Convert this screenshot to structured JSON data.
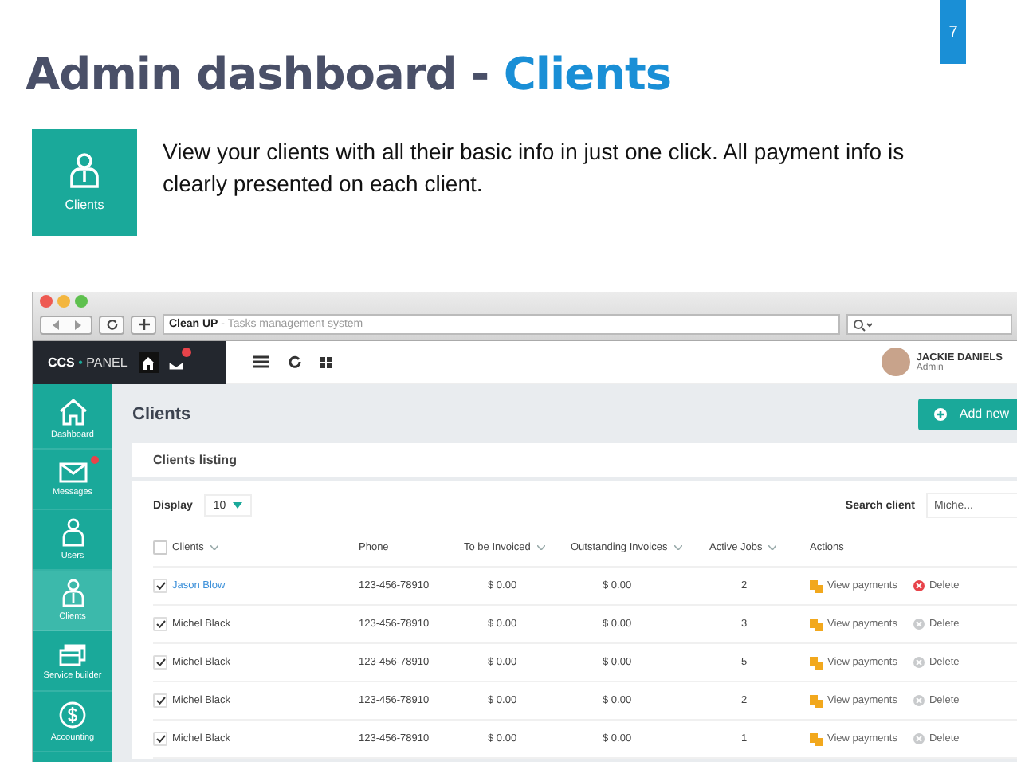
{
  "slide": {
    "page_number": "7",
    "title": "Admin dashboard - ",
    "title_highlight": "Clients",
    "tile_label": "Clients",
    "description": "View your clients with all their basic info in just one click. All payment info is clearly presented on each client."
  },
  "browser": {
    "address_title": "Clean UP",
    "address_rest": " - Tasks management system"
  },
  "header": {
    "brand": "CCS",
    "separator": "•",
    "brand_rest": "PANEL",
    "user_name": "JACKIE DANIELS",
    "user_role": "Admin"
  },
  "sidebar": {
    "items": [
      {
        "label": "Dashboard",
        "selected": false,
        "badge": false
      },
      {
        "label": "Messages",
        "selected": false,
        "badge": true
      },
      {
        "label": "Users",
        "selected": false,
        "badge": false
      },
      {
        "label": "Clients",
        "selected": true,
        "badge": false
      },
      {
        "label": "Service builder",
        "selected": false,
        "badge": false
      },
      {
        "label": "Accounting",
        "selected": false,
        "badge": false
      }
    ]
  },
  "page": {
    "title": "Clients",
    "add_button": "Add new",
    "card_title": "Clients listing",
    "display_label": "Display",
    "display_value": "10",
    "search_label": "Search client",
    "search_value": "Miche..."
  },
  "table": {
    "header_checked": false,
    "columns": [
      {
        "label": "Clients",
        "sortable": true
      },
      {
        "label": "Phone",
        "sortable": false
      },
      {
        "label": "To be Invoiced",
        "sortable": true
      },
      {
        "label": "Outstanding Invoices",
        "sortable": true
      },
      {
        "label": "Active Jobs",
        "sortable": true
      },
      {
        "label": "Actions",
        "sortable": false
      }
    ],
    "rows": [
      {
        "checked": true,
        "highlighted": true,
        "name": "Jason Blow",
        "phone": "123-456-78910",
        "to_invoice": "$ 0.00",
        "outstanding": "$ 0.00",
        "jobs": "2",
        "view": "View payments",
        "delete": "Delete"
      },
      {
        "checked": true,
        "highlighted": false,
        "name": "Michel Black",
        "phone": "123-456-78910",
        "to_invoice": "$ 0.00",
        "outstanding": "$ 0.00",
        "jobs": "3",
        "view": "View payments",
        "delete": "Delete"
      },
      {
        "checked": true,
        "highlighted": false,
        "name": "Michel Black",
        "phone": "123-456-78910",
        "to_invoice": "$ 0.00",
        "outstanding": "$ 0.00",
        "jobs": "5",
        "view": "View payments",
        "delete": "Delete"
      },
      {
        "checked": true,
        "highlighted": false,
        "name": "Michel Black",
        "phone": "123-456-78910",
        "to_invoice": "$ 0.00",
        "outstanding": "$ 0.00",
        "jobs": "2",
        "view": "View payments",
        "delete": "Delete"
      },
      {
        "checked": true,
        "highlighted": false,
        "name": "Michel Black",
        "phone": "123-456-78910",
        "to_invoice": "$ 0.00",
        "outstanding": "$ 0.00",
        "jobs": "1",
        "view": "View payments",
        "delete": "Delete"
      }
    ]
  }
}
